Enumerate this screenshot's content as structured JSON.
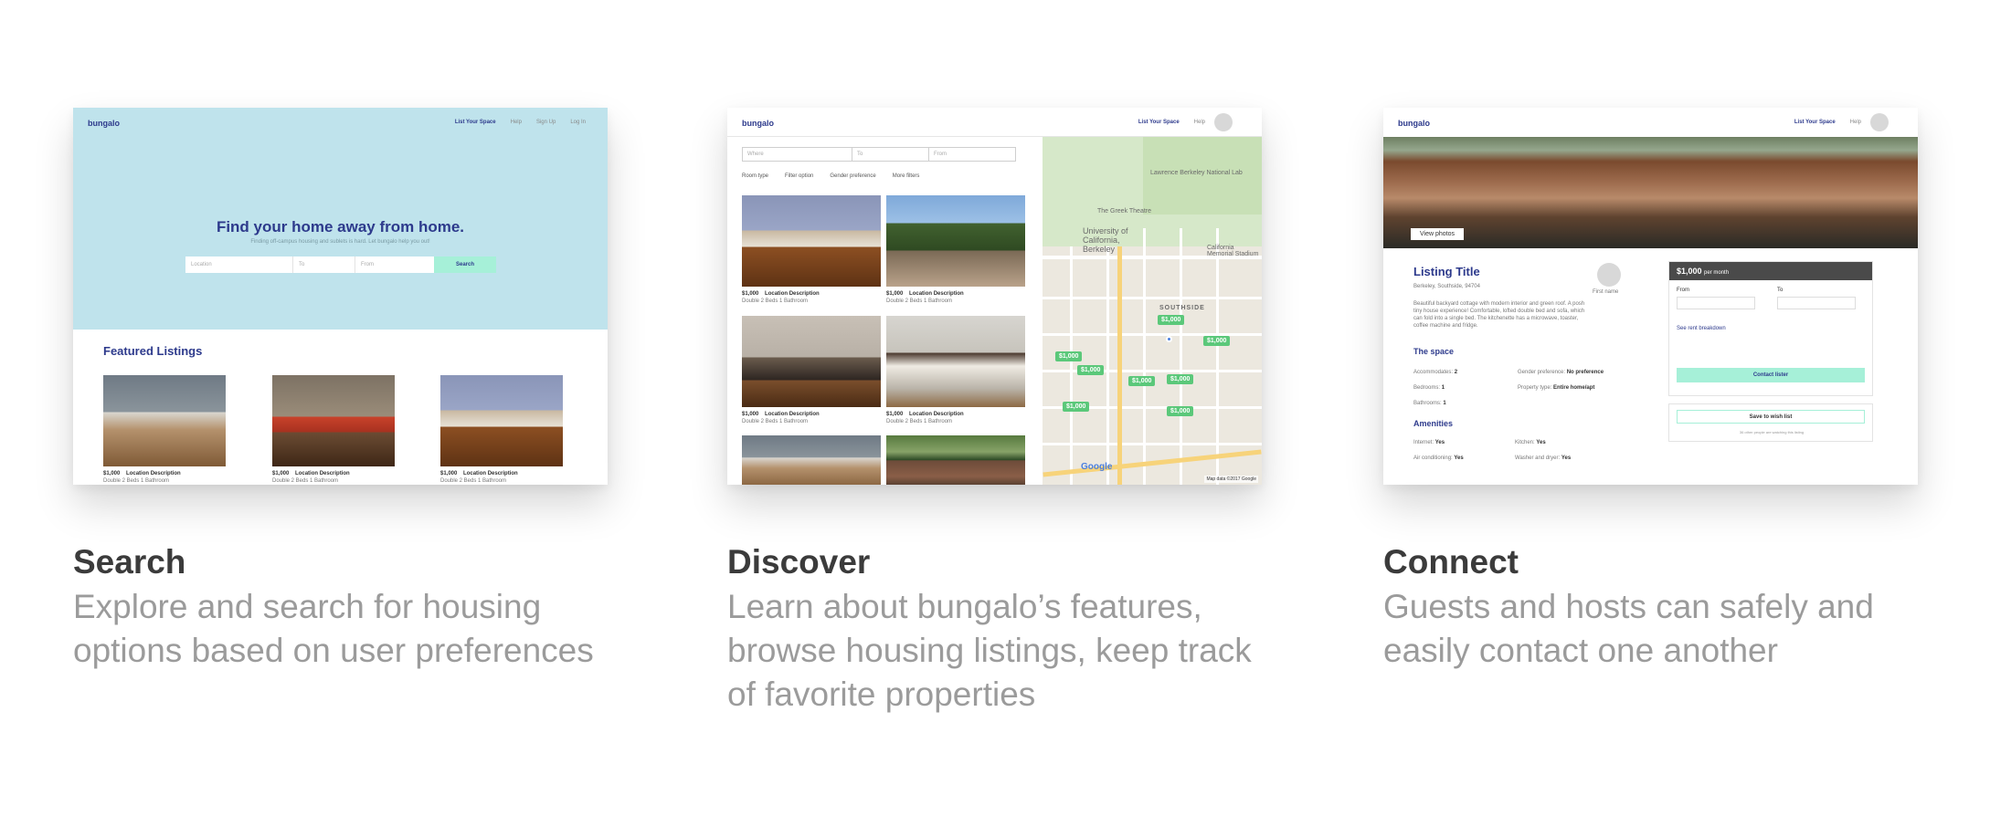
{
  "panels": [
    {
      "title": "Search",
      "description": "Explore and search for housing options based on user preferences",
      "screen": {
        "logo": "bungalo",
        "nav": [
          "List Your Space",
          "Help",
          "Sign Up",
          "Log In"
        ],
        "hero_title": "Find your home away from home.",
        "hero_subtitle": "Finding off-campus housing and sublets is hard. Let bungalo help you out!",
        "search_location_placeholder": "Location",
        "search_to_placeholder": "To",
        "search_from_placeholder": "From",
        "search_button": "Search",
        "featured_title": "Featured Listings",
        "listings": [
          {
            "price": "$1,000",
            "location": "Location Description",
            "details": "Double    2 Beds    1 Bathroom"
          },
          {
            "price": "$1,000",
            "location": "Location Description",
            "details": "Double    2 Beds    1 Bathroom"
          },
          {
            "price": "$1,000",
            "location": "Location Description",
            "details": "Double    2 Beds    1 Bathroom"
          }
        ]
      }
    },
    {
      "title": "Discover",
      "description": "Learn about bungalo’s features, browse housing listings, keep track of favorite properties",
      "screen": {
        "logo": "bungalo",
        "nav": [
          "List Your Space",
          "Help"
        ],
        "where_placeholder": "Where",
        "to_placeholder": "To",
        "from_placeholder": "From",
        "filters": [
          "Room type",
          "Filter option",
          "Gender preference",
          "More filters"
        ],
        "listings": [
          {
            "price": "$1,000",
            "location": "Location Description",
            "details": "Double    2 Beds    1 Bathroom"
          },
          {
            "price": "$1,000",
            "location": "Location Description",
            "details": "Double    2 Beds    1 Bathroom"
          },
          {
            "price": "$1,000",
            "location": "Location Description",
            "details": "Double    2 Beds    1 Bathroom"
          },
          {
            "price": "$1,000",
            "location": "Location Description",
            "details": "Double    2 Beds    1 Bathroom"
          }
        ],
        "map_labels": [
          "Lawrence Berkeley National Lab",
          "The Greek Theatre",
          "University of California, Berkeley",
          "California Memorial Stadium",
          "SOUTHSIDE"
        ],
        "map_pins": [
          "$1,000",
          "$1,000",
          "$1,000",
          "$1,000",
          "$1,000",
          "$1,000",
          "$1,000",
          "$1,000"
        ],
        "map_credit": "Map data ©2017 Google",
        "google": "Google"
      }
    },
    {
      "title": "Connect",
      "description": "Guests and hosts can safely and easily contact one another",
      "screen": {
        "logo": "bungalo",
        "nav": [
          "List Your Space",
          "Help"
        ],
        "view_photos": "View photos",
        "listing_title": "Listing Title",
        "address": "Berkeley, Southside, 94704",
        "host_name": "First name",
        "blurb": "Beautiful backyard cottage with modern interior and green roof. A posh tiny house experience! Comfortable, lofted double bed and sofa, which can fold into a single bed. The kitchenette has a microwave, toaster, coffee machine and fridge.",
        "space_title": "The space",
        "space_left": [
          {
            "label": "Accommodates:",
            "value": "2"
          },
          {
            "label": "Bedrooms:",
            "value": "1"
          },
          {
            "label": "Bathrooms:",
            "value": "1"
          }
        ],
        "space_right": [
          {
            "label": "Gender preference:",
            "value": "No preference"
          },
          {
            "label": "Property type:",
            "value": "Entire home/apt"
          }
        ],
        "amenities_title": "Amenities",
        "amenities_left": [
          {
            "label": "Internet:",
            "value": "Yes"
          },
          {
            "label": "Air conditioning:",
            "value": "Yes"
          }
        ],
        "amenities_right": [
          {
            "label": "Kitchen:",
            "value": "Yes"
          },
          {
            "label": "Washer and dryer:",
            "value": "Yes"
          }
        ],
        "price": "$1,000",
        "per": "per month",
        "from_label": "From",
        "to_label": "To",
        "rent_breakdown": "See rent breakdown",
        "contact_button": "Contact lister",
        "wishlist_button": "Save to wish list",
        "wishlist_note": "36 other people are watching this listing"
      }
    }
  ],
  "colors": {
    "brand": "#2d3a8c",
    "hero_bg": "#bfe3ec",
    "accent": "#a6f0d8",
    "pin": "#5bc87a"
  }
}
